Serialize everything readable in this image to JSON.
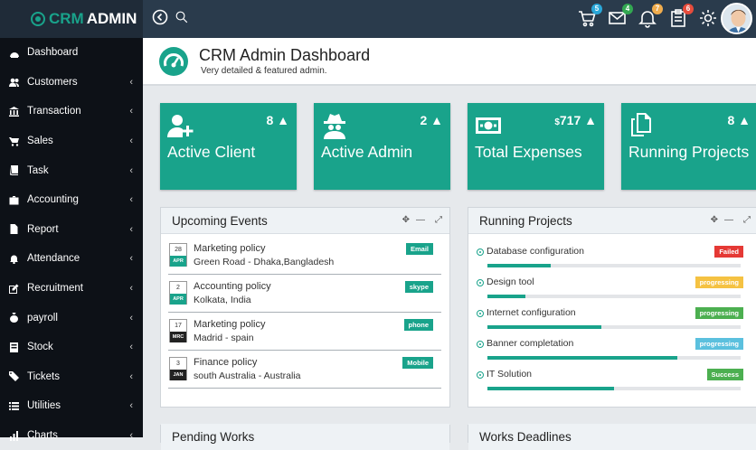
{
  "brand": {
    "crm": "CRM",
    "admin": "ADMIN"
  },
  "sidebar": {
    "items": [
      {
        "label": "Dashboard",
        "icon": "dashboard-icon",
        "chevron": false
      },
      {
        "label": "Customers",
        "icon": "users-icon",
        "chevron": true
      },
      {
        "label": "Transaction",
        "icon": "bank-icon",
        "chevron": true
      },
      {
        "label": "Sales",
        "icon": "cart-icon",
        "chevron": true
      },
      {
        "label": "Task",
        "icon": "book-icon",
        "chevron": true
      },
      {
        "label": "Accounting",
        "icon": "briefcase-icon",
        "chevron": true
      },
      {
        "label": "Report",
        "icon": "file-icon",
        "chevron": true
      },
      {
        "label": "Attendance",
        "icon": "bell-icon",
        "chevron": true
      },
      {
        "label": "Recruitment",
        "icon": "edit-icon",
        "chevron": true
      },
      {
        "label": "payroll",
        "icon": "money-bag-icon",
        "chevron": true
      },
      {
        "label": "Stock",
        "icon": "stock-icon",
        "chevron": true
      },
      {
        "label": "Tickets",
        "icon": "ticket-icon",
        "chevron": true
      },
      {
        "label": "Utilities",
        "icon": "list-icon",
        "chevron": true
      },
      {
        "label": "Charts",
        "icon": "chart-icon",
        "chevron": true
      }
    ]
  },
  "topbar": {
    "badges": {
      "cart": "5",
      "mail": "4",
      "bell": "7",
      "tasks": "6"
    },
    "colors": {
      "cart": "#2aa7d8",
      "mail": "#33a852",
      "bell": "#f0ad4e",
      "tasks": "#e74c3c"
    }
  },
  "header": {
    "title": "CRM Admin Dashboard",
    "subtitle": "Very detailed & featured admin."
  },
  "stats": [
    {
      "label": "Active Client",
      "value": "8",
      "icon": "add-user-icon"
    },
    {
      "label": "Active Admin",
      "value": "2",
      "icon": "spy-icon"
    },
    {
      "label": "Total Expenses",
      "value": "717",
      "prefix": "$",
      "icon": "money-icon"
    },
    {
      "label": "Running Projects",
      "value": "8",
      "icon": "files-icon"
    }
  ],
  "events": {
    "title": "Upcoming Events",
    "items": [
      {
        "day": "28",
        "month": "APR",
        "month_color": "#19a38b",
        "title": "Marketing policy",
        "location": "Green Road - Dhaka,Bangladesh",
        "tag": "Email"
      },
      {
        "day": "2",
        "month": "APR",
        "month_color": "#19a38b",
        "title": "Accounting policy",
        "location": "Kolkata, India",
        "tag": "skype"
      },
      {
        "day": "17",
        "month": "MRC",
        "month_color": "#222222",
        "title": "Marketing policy",
        "location": "Madrid - spain",
        "tag": "phone"
      },
      {
        "day": "3",
        "month": "JAN",
        "month_color": "#222222",
        "title": "Finance policy",
        "location": "south Australia - Australia",
        "tag": "Mobile"
      }
    ]
  },
  "projects": {
    "title": "Running Projects",
    "items": [
      {
        "name": "Database configuration",
        "status": "Failed",
        "color": "#e53935",
        "progress": 25
      },
      {
        "name": "Design tool",
        "status": "progressing",
        "color": "#f5c242",
        "progress": 15
      },
      {
        "name": "Internet configuration",
        "status": "progressing",
        "color": "#4caf50",
        "progress": 45
      },
      {
        "name": "Banner completation",
        "status": "progressing",
        "color": "#5bc0de",
        "progress": 75
      },
      {
        "name": "IT Solution",
        "status": "Success",
        "color": "#4caf50",
        "progress": 50
      }
    ]
  },
  "bottom_panels": {
    "left": "Pending Works",
    "right": "Works Deadlines"
  }
}
